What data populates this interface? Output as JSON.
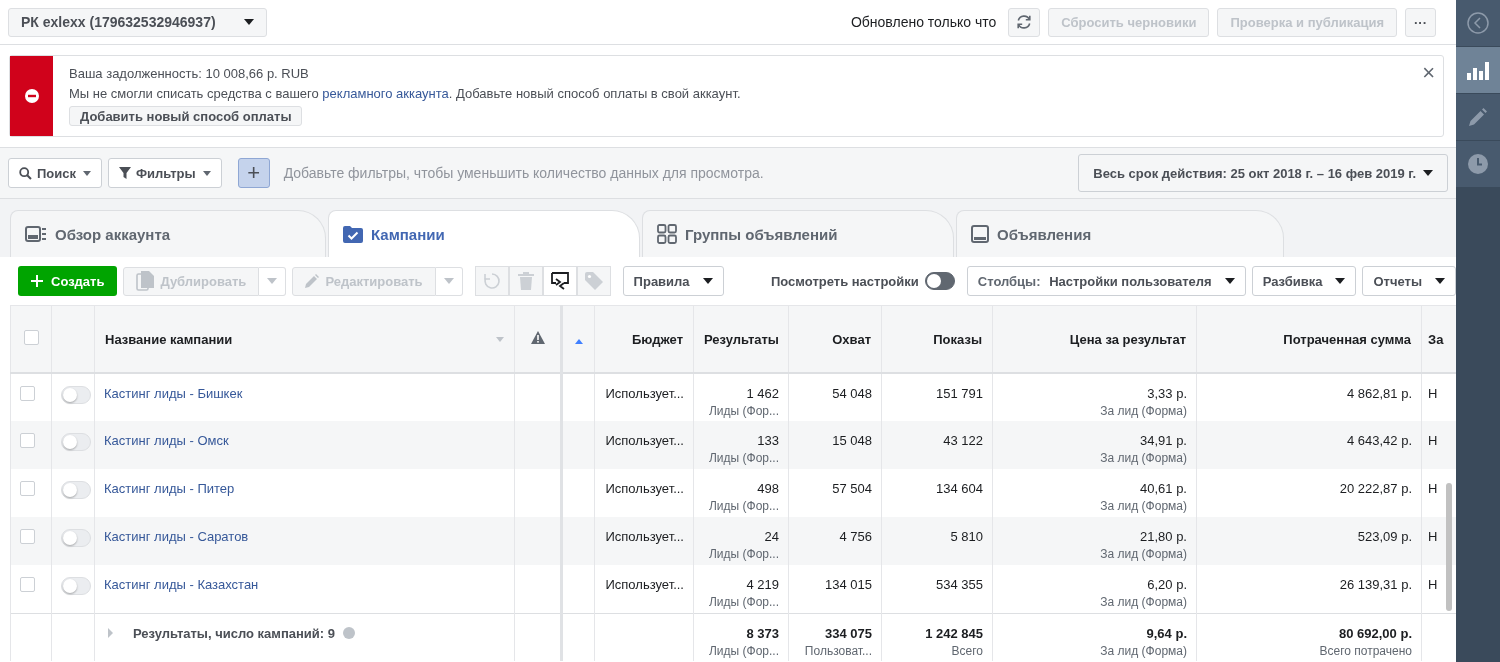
{
  "account_selector": {
    "label": "РК exlexx (179632532946937)"
  },
  "top_bar": {
    "status": "Обновлено только что",
    "buttons": [
      {
        "label": "Сбросить черновики",
        "disabled": true
      },
      {
        "label": "Проверка и публикация",
        "disabled": true
      }
    ],
    "more": "···"
  },
  "alert": {
    "title": "Ваша задолженность: 10 008,66 р. RUB",
    "message_before": "Мы не смогли списать средства с вашего",
    "link": "рекламного аккаунта",
    "message_after": ". Добавьте новый способ оплаты в свой аккаунт.",
    "button": "Добавить новый способ оплаты",
    "close": "×"
  },
  "filter_bar": {
    "search": "Поиск",
    "filters": "Фильтры",
    "plus": "+",
    "hint": "Добавьте фильтры, чтобы уменьшить количество данных для просмотра.",
    "date_range": "Весь срок действия: 25 окт 2018 г. – 16 фев 2019 г."
  },
  "tabs": [
    {
      "label": "Обзор аккаунта",
      "selected": false
    },
    {
      "label": "Кампании",
      "selected": true
    },
    {
      "label": "Группы объявлений",
      "selected": false
    },
    {
      "label": "Объявления",
      "selected": false
    }
  ],
  "toolbar": {
    "create": "Создать",
    "duplicate": {
      "label": "Дублировать",
      "disabled": true
    },
    "edit": {
      "label": "Редактировать",
      "disabled": true
    },
    "rules": "Правила",
    "view_settings": {
      "label": "Посмотреть настройки",
      "on": false
    },
    "columns_prefix": "Столбцы:",
    "columns_value": "Настройки пользователя",
    "breakdown": "Разбивка",
    "reports": "Отчеты"
  },
  "table": {
    "select_all_checked": false,
    "columns": [
      "Название кампании",
      "Бюджет",
      "Результаты",
      "Охват",
      "Показы",
      "Цена за результат",
      "Потраченная сумма",
      "За"
    ],
    "rows": [
      {
        "checked": false,
        "on": false,
        "name": "Кастинг лиды - Бишкек",
        "budget": "Использует...",
        "results": "1 462",
        "results_sub": "Лиды (Фор...",
        "reach": "54 048",
        "impressions": "151 791",
        "cost": "3,33 р.",
        "cost_sub": "За лид (Форма)",
        "spent": "4 862,81 р.",
        "column_8": "Н"
      },
      {
        "checked": false,
        "on": false,
        "name": "Кастинг лиды - Омск",
        "budget": "Использует...",
        "results": "133",
        "results_sub": "Лиды (Фор...",
        "reach": "15 048",
        "impressions": "43 122",
        "cost": "34,91 р.",
        "cost_sub": "За лид (Форма)",
        "spent": "4 643,42 р.",
        "column_8": "Н"
      },
      {
        "checked": false,
        "on": false,
        "name": "Кастинг лиды - Питер",
        "budget": "Использует...",
        "results": "498",
        "results_sub": "Лиды (Фор...",
        "reach": "57 504",
        "impressions": "134 604",
        "cost": "40,61 р.",
        "cost_sub": "За лид (Форма)",
        "spent": "20 222,87 р.",
        "column_8": "Н"
      },
      {
        "checked": false,
        "on": false,
        "name": "Кастинг лиды - Саратов",
        "budget": "Использует...",
        "results": "24",
        "results_sub": "Лиды (Фор...",
        "reach": "4 756",
        "impressions": "5 810",
        "cost": "21,80 р.",
        "cost_sub": "За лид (Форма)",
        "spent": "523,09 р.",
        "column_8": "Н"
      },
      {
        "checked": false,
        "on": false,
        "name": "Кастинг лиды - Казахстан",
        "budget": "Использует...",
        "results": "4 219",
        "results_sub": "Лиды (Фор...",
        "reach": "134 015",
        "impressions": "534 355",
        "cost": "6,20 р.",
        "cost_sub": "За лид (Форма)",
        "spent": "26 139,31 р.",
        "column_8": "Н"
      }
    ],
    "totals": {
      "label": "Результаты, число кампаний: 9",
      "results": "8 373",
      "results_sub": "Лиды (Фор...",
      "reach": "334 075",
      "reach_sub": "Пользоват...",
      "impressions": "1 242 845",
      "impressions_sub": "Всего",
      "cost": "9,64 р.",
      "cost_sub": "За лид (Форма)",
      "spent": "80 692,00 р.",
      "spent_sub": "Всего потрачено"
    }
  },
  "side_rail": {
    "items": [
      {
        "selected": false
      },
      {
        "selected": true
      },
      {
        "selected": false
      },
      {
        "selected": false
      }
    ]
  }
}
